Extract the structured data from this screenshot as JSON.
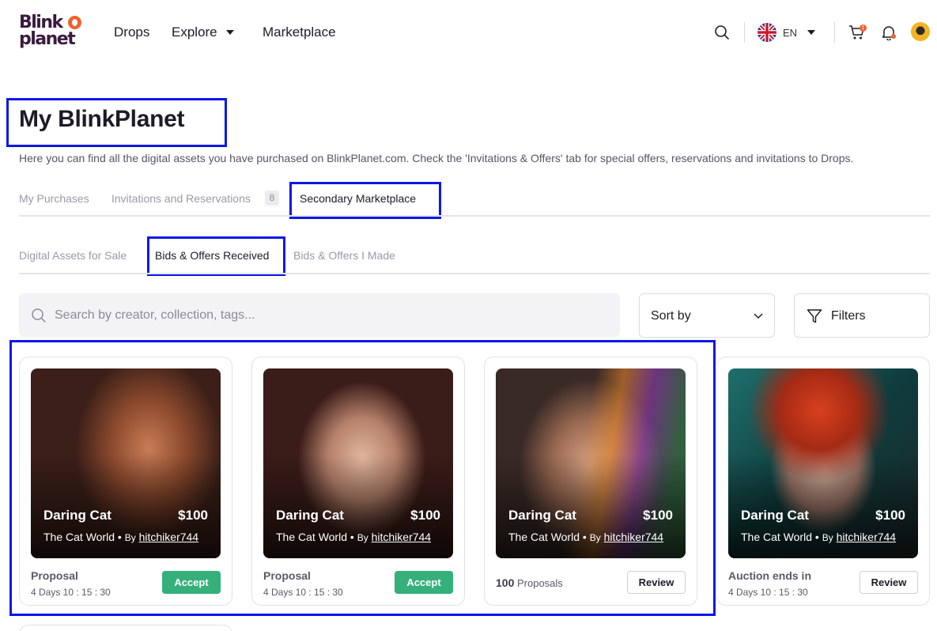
{
  "header": {
    "logo_line1": "Blink",
    "logo_line2": "planet",
    "nav": {
      "drops": "Drops",
      "explore": "Explore",
      "marketplace": "Marketplace"
    },
    "language": "EN",
    "cart_count": "1"
  },
  "page": {
    "title": "My BlinkPlanet",
    "description": "Here you can find all the digital assets you have purchased on BlinkPlanet.com. Check the 'Invitations & Offers' tab for special offers, reservations and invitations to Drops."
  },
  "tabs": {
    "purchases": "My Purchases",
    "invitations": "Invitations and Reservations",
    "invitations_count": "8",
    "secondary": "Secondary Marketplace"
  },
  "subtabs": {
    "for_sale": "Digital Assets for Sale",
    "received": "Bids & Offers Received",
    "made": "Bids & Offers I Made"
  },
  "search": {
    "placeholder": "Search by creator, collection, tags..."
  },
  "sort_label": "Sort by",
  "filters_label": "Filters",
  "cards": [
    {
      "name": "Daring Cat",
      "price": "$100",
      "collection": "The Cat World",
      "by": "By",
      "creator": "hitchiker744",
      "status_label": "Proposal",
      "time": "4 Days  10 : 15 : 30",
      "action": "Accept"
    },
    {
      "name": "Daring Cat",
      "price": "$100",
      "collection": "The Cat World",
      "by": "By",
      "creator": "hitchiker744",
      "status_label": "Proposal",
      "time": "4 Days  10 : 15 : 30",
      "action": "Accept"
    },
    {
      "name": "Daring Cat",
      "price": "$100",
      "collection": "The Cat World",
      "by": "By",
      "creator": "hitchiker744",
      "proposals_count": "100",
      "proposals_label": "Proposals",
      "action": "Review"
    },
    {
      "name": "Daring Cat",
      "price": "$100",
      "collection": "The Cat World",
      "by": "By",
      "creator": "hitchiker744",
      "status_label": "Auction ends in",
      "time": "4 Days  10 : 15 : 30",
      "action": "Review"
    }
  ],
  "colors": {
    "accent_orange": "#f0622d",
    "accept_green": "#35b07a",
    "highlight_blue": "#0a18e6"
  }
}
